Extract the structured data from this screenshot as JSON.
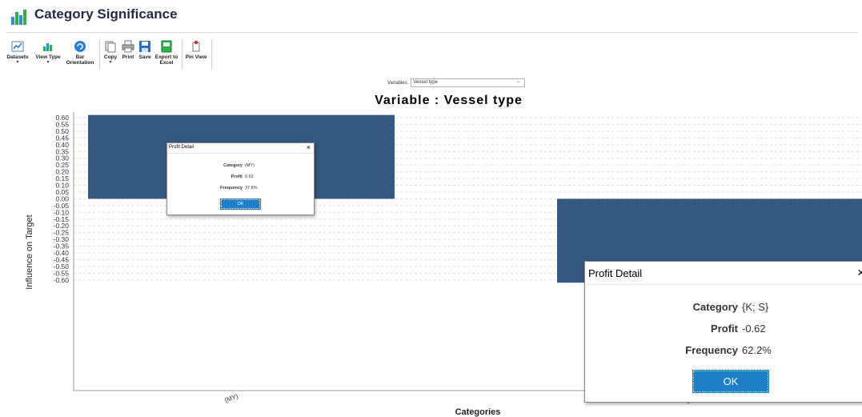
{
  "window": {
    "title": "Category Significance"
  },
  "toolbar": {
    "buttons": [
      {
        "label": "Datasets",
        "has_menu": true
      },
      {
        "label": "View Type",
        "has_menu": true
      },
      {
        "label": "Bar\nOrientation",
        "has_menu": false
      },
      {
        "label": "Copy",
        "has_menu": true
      },
      {
        "label": "Print",
        "has_menu": false
      },
      {
        "label": "Save",
        "has_menu": false
      },
      {
        "label": "Export to\nExcel",
        "has_menu": false
      },
      {
        "label": "Pin View",
        "has_menu": false
      }
    ],
    "menu_arrow": "▾"
  },
  "variables": {
    "label": "Variables:",
    "selected": "Vessel type"
  },
  "chart_data": {
    "type": "bar",
    "title": "Variable : Vessel type",
    "xlabel": "Categories",
    "ylabel": "Influence on Target",
    "categories": [
      "(MY)",
      "{K; S}"
    ],
    "values": [
      0.62,
      -0.62
    ],
    "ylim": [
      -0.65,
      0.65
    ],
    "yticks": [
      "0.60",
      "0.55",
      "0.50",
      "0.45",
      "0.40",
      "0.35",
      "0.30",
      "0.25",
      "0.20",
      "0.15",
      "0.10",
      "0.05",
      "0.00",
      "-0.05",
      "-0.10",
      "-0.15",
      "-0.20",
      "-0.25",
      "-0.30",
      "-0.35",
      "-0.40",
      "-0.45",
      "-0.50",
      "-0.55",
      "-0.60"
    ],
    "bar_color": "#34587f",
    "grid": true
  },
  "dialogs": [
    {
      "title": "Profit Detail",
      "close": "×",
      "category_label": "Category",
      "category_value": "(MY)",
      "profit_label": "Profit",
      "profit_value": "0.62",
      "frequency_label": "Frequency",
      "frequency_value": "37.8%",
      "ok_label": "OK"
    },
    {
      "title": "Profit Detail",
      "close": "×",
      "category_label": "Category",
      "category_value": "{K; S}",
      "profit_label": "Profit",
      "profit_value": "-0.62",
      "frequency_label": "Frequency",
      "frequency_value": "62.2%",
      "ok_label": "OK"
    }
  ]
}
